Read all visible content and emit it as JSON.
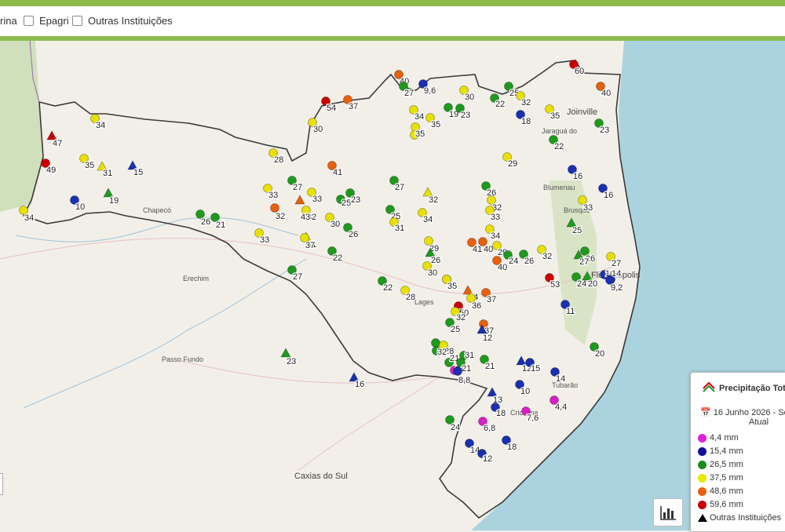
{
  "filters": [
    {
      "label": "rina"
    },
    {
      "label": "Epagri"
    },
    {
      "label": "Outras Instituições"
    }
  ],
  "legend": {
    "title": "Precipitação Tot",
    "date": "16 Junho 2026 - So",
    "subtitle": "Atual",
    "classes": [
      {
        "label": "4,4 mm",
        "color": "#e020e0"
      },
      {
        "label": "15,4 mm",
        "color": "#10109a"
      },
      {
        "label": "26,5 mm",
        "color": "#1a8c1a"
      },
      {
        "label": "37,5 mm",
        "color": "#e8e800"
      },
      {
        "label": "48,6 mm",
        "color": "#e86010"
      },
      {
        "label": "59,6 mm",
        "color": "#c80000"
      }
    ],
    "other_institutions_label": "Outras Instituições"
  },
  "cities": [
    "Joinville",
    "Jaraguá do",
    "Blumenau",
    "Brusque",
    "Florianópolis",
    "Chapecó",
    "Erechim",
    "Passo Fundo",
    "Caxias do Sul",
    "Criciúma",
    "Tubarão",
    "Lages"
  ],
  "stations": [
    {
      "v": "47",
      "c": "r",
      "t": 1
    },
    {
      "v": "49",
      "c": "r",
      "t": 0
    },
    {
      "v": "34",
      "c": "y",
      "t": 0
    },
    {
      "v": "35",
      "c": "y",
      "t": 0
    },
    {
      "v": "31",
      "c": "y",
      "t": 1
    },
    {
      "v": "15",
      "c": "b",
      "t": 1
    },
    {
      "v": "10",
      "c": "b",
      "t": 0
    },
    {
      "v": "19",
      "c": "g",
      "t": 1
    },
    {
      "v": "34",
      "c": "y",
      "t": 0
    },
    {
      "v": "26",
      "c": "g",
      "t": 0
    },
    {
      "v": "21",
      "c": "g",
      "t": 0
    },
    {
      "v": "33",
      "c": "y",
      "t": 0
    },
    {
      "v": "28",
      "c": "y",
      "t": 0
    },
    {
      "v": "27",
      "c": "g",
      "t": 0
    },
    {
      "v": "33",
      "c": "y",
      "t": 0
    },
    {
      "v": "33",
      "c": "y",
      "t": 0
    },
    {
      "v": "32",
      "c": "y",
      "t": 0
    },
    {
      "v": "32",
      "c": "o",
      "t": 0
    },
    {
      "v": "43",
      "c": "o",
      "t": 1
    },
    {
      "v": "41",
      "c": "y",
      "t": 1
    },
    {
      "v": "41",
      "c": "o",
      "t": 0
    },
    {
      "v": "30",
      "c": "y",
      "t": 0
    },
    {
      "v": "25",
      "c": "g",
      "t": 0
    },
    {
      "v": "23",
      "c": "g",
      "t": 0
    },
    {
      "v": "26",
      "c": "g",
      "t": 0
    },
    {
      "v": "37",
      "c": "y",
      "t": 0
    },
    {
      "v": "22",
      "c": "g",
      "t": 0
    },
    {
      "v": "27",
      "c": "g",
      "t": 0
    },
    {
      "v": "54",
      "c": "r",
      "t": 0
    },
    {
      "v": "37",
      "c": "o",
      "t": 0
    },
    {
      "v": "30",
      "c": "y",
      "t": 0
    },
    {
      "v": "40",
      "c": "o",
      "t": 0
    },
    {
      "v": "27",
      "c": "g",
      "t": 0
    },
    {
      "v": "9,6",
      "c": "b",
      "t": 0
    },
    {
      "v": "30",
      "c": "y",
      "t": 0
    },
    {
      "v": "19",
      "c": "g",
      "t": 0
    },
    {
      "v": "23",
      "c": "g",
      "t": 0
    },
    {
      "v": "34",
      "c": "y",
      "t": 0
    },
    {
      "v": "35",
      "c": "y",
      "t": 0
    },
    {
      "v": "37",
      "c": "y",
      "t": 0
    },
    {
      "v": "35",
      "c": "y",
      "t": 0
    },
    {
      "v": "27",
      "c": "g",
      "t": 0
    },
    {
      "v": "25",
      "c": "g",
      "t": 0
    },
    {
      "v": "31",
      "c": "y",
      "t": 0
    },
    {
      "v": "22",
      "c": "g",
      "t": 0
    },
    {
      "v": "28",
      "c": "y",
      "t": 0
    },
    {
      "v": "32",
      "c": "y",
      "t": 1
    },
    {
      "v": "34",
      "c": "y",
      "t": 0
    },
    {
      "v": "29",
      "c": "y",
      "t": 0
    },
    {
      "v": "26",
      "c": "g",
      "t": 1
    },
    {
      "v": "30",
      "c": "y",
      "t": 0
    },
    {
      "v": "35",
      "c": "y",
      "t": 0
    },
    {
      "v": "25",
      "c": "g",
      "t": 0
    },
    {
      "v": "22",
      "c": "g",
      "t": 0
    },
    {
      "v": "32",
      "c": "y",
      "t": 0
    },
    {
      "v": "18",
      "c": "b",
      "t": 0
    },
    {
      "v": "35",
      "c": "y",
      "t": 0
    },
    {
      "v": "29",
      "c": "y",
      "t": 0
    },
    {
      "v": "26",
      "c": "g",
      "t": 0
    },
    {
      "v": "32",
      "c": "y",
      "t": 0
    },
    {
      "v": "33",
      "c": "y",
      "t": 0
    },
    {
      "v": "34",
      "c": "y",
      "t": 0
    },
    {
      "v": "41",
      "c": "o",
      "t": 0
    },
    {
      "v": "40",
      "c": "o",
      "t": 0
    },
    {
      "v": "29",
      "c": "y",
      "t": 0
    },
    {
      "v": "24",
      "c": "g",
      "t": 0
    },
    {
      "v": "26",
      "c": "g",
      "t": 0
    },
    {
      "v": "40",
      "c": "o",
      "t": 0
    },
    {
      "v": "32",
      "c": "y",
      "t": 0
    },
    {
      "v": "60",
      "c": "r",
      "t": 0
    },
    {
      "v": "40",
      "c": "o",
      "t": 0
    },
    {
      "v": "23",
      "c": "g",
      "t": 0
    },
    {
      "v": "22",
      "c": "g",
      "t": 0
    },
    {
      "v": "16",
      "c": "b",
      "t": 0
    },
    {
      "v": "16",
      "c": "b",
      "t": 0
    },
    {
      "v": "33",
      "c": "y",
      "t": 0
    },
    {
      "v": "25",
      "c": "g",
      "t": 1
    },
    {
      "v": "26",
      "c": "g",
      "t": 0
    },
    {
      "v": "27",
      "c": "g",
      "t": 1
    },
    {
      "v": "27",
      "c": "y",
      "t": 0
    },
    {
      "v": "53",
      "c": "r",
      "t": 0
    },
    {
      "v": "24",
      "c": "g",
      "t": 0
    },
    {
      "v": "20",
      "c": "g",
      "t": 1
    },
    {
      "v": "16",
      "c": "b",
      "t": 0
    },
    {
      "v": "14",
      "c": "b",
      "t": 0
    },
    {
      "v": "9,2",
      "c": "b",
      "t": 0
    },
    {
      "v": "11",
      "c": "b",
      "t": 0
    },
    {
      "v": "20",
      "c": "g",
      "t": 0
    },
    {
      "v": "35",
      "c": "y",
      "t": 0
    },
    {
      "v": "44",
      "c": "o",
      "t": 1
    },
    {
      "v": "37",
      "c": "o",
      "t": 0
    },
    {
      "v": "36",
      "c": "y",
      "t": 0
    },
    {
      "v": "50",
      "c": "r",
      "t": 0
    },
    {
      "v": "32",
      "c": "y",
      "t": 0
    },
    {
      "v": "25",
      "c": "g",
      "t": 0
    },
    {
      "v": "37",
      "c": "o",
      "t": 0
    },
    {
      "v": "12",
      "c": "b",
      "t": 1
    },
    {
      "v": "24",
      "c": "g",
      "t": 0
    },
    {
      "v": "28",
      "c": "y",
      "t": 0
    },
    {
      "v": "32",
      "c": "g",
      "t": 0
    },
    {
      "v": "31",
      "c": "g",
      "t": 0
    },
    {
      "v": "21",
      "c": "g",
      "t": 0
    },
    {
      "v": "24",
      "c": "m",
      "t": 0
    },
    {
      "v": "21",
      "c": "g",
      "t": 0
    },
    {
      "v": "8,8",
      "c": "b",
      "t": 0
    },
    {
      "v": "21",
      "c": "g",
      "t": 0
    },
    {
      "v": "12",
      "c": "b",
      "t": 1
    },
    {
      "v": "15",
      "c": "b",
      "t": 0
    },
    {
      "v": "14",
      "c": "b",
      "t": 0
    },
    {
      "v": "10",
      "c": "b",
      "t": 0
    },
    {
      "v": "13",
      "c": "b",
      "t": 1
    },
    {
      "v": "18",
      "c": "b",
      "t": 0
    },
    {
      "v": "4,4",
      "c": "m",
      "t": 0
    },
    {
      "v": "7,6",
      "c": "m",
      "t": 0
    },
    {
      "v": "6,8",
      "c": "m",
      "t": 0
    },
    {
      "v": "24",
      "c": "g",
      "t": 0
    },
    {
      "v": "18",
      "c": "b",
      "t": 0
    },
    {
      "v": "14",
      "c": "b",
      "t": 0
    },
    {
      "v": "12",
      "c": "b",
      "t": 0
    },
    {
      "v": "23",
      "c": "g",
      "t": 1
    },
    {
      "v": "16",
      "c": "b",
      "t": 1
    }
  ],
  "colors": {
    "r": "#cc0000",
    "o": "#e8600c",
    "y": "#e8e000",
    "g": "#1e9a1e",
    "b": "#1a30b0",
    "m": "#d820c8"
  }
}
